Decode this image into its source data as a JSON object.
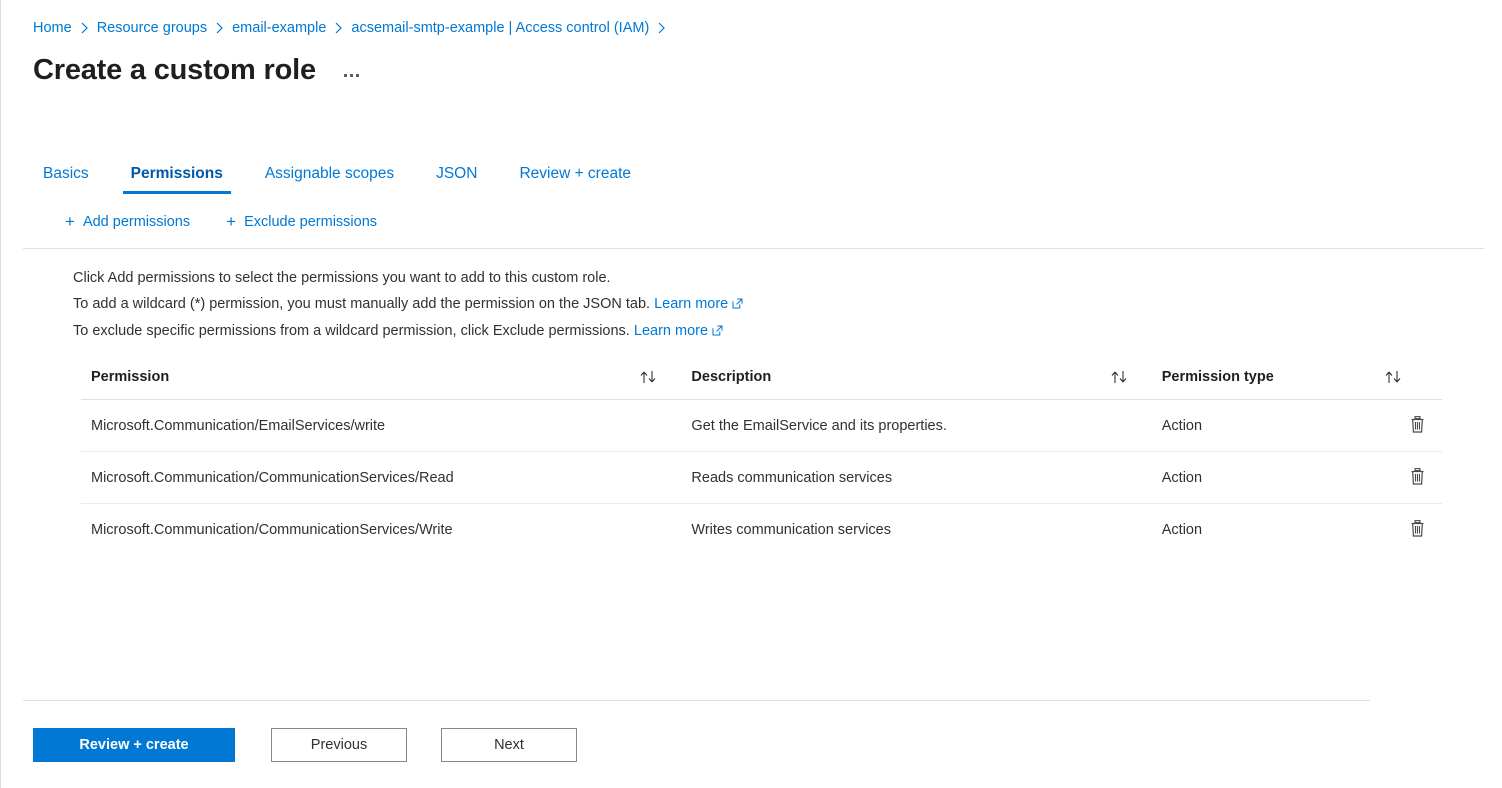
{
  "breadcrumb": {
    "separator_icon": "chevron-right-icon",
    "items": [
      {
        "label": "Home"
      },
      {
        "label": "Resource groups"
      },
      {
        "label": "email-example"
      },
      {
        "label": "acsemail-smtp-example | Access control (IAM)"
      }
    ]
  },
  "header": {
    "title": "Create a custom role",
    "more_menu_icon": "ellipsis-icon"
  },
  "tabs": [
    {
      "label": "Basics",
      "active": false
    },
    {
      "label": "Permissions",
      "active": true
    },
    {
      "label": "Assignable scopes",
      "active": false
    },
    {
      "label": "JSON",
      "active": false
    },
    {
      "label": "Review + create",
      "active": false
    }
  ],
  "command_bar": {
    "add_permissions_label": "Add permissions",
    "exclude_permissions_label": "Exclude permissions",
    "add_icon": "plus-icon",
    "exclude_icon": "plus-icon"
  },
  "instructions": {
    "line1": "Click Add permissions to select the permissions you want to add to this custom role.",
    "line2_text": "To add a wildcard (*) permission, you must manually add the permission on the JSON tab.",
    "line2_link": "Learn more",
    "line3_text": "To exclude specific permissions from a wildcard permission, click Exclude permissions.",
    "line3_link": "Learn more",
    "external_link_icon": "external-link-icon"
  },
  "table": {
    "columns": [
      {
        "label": "Permission",
        "sortable": true,
        "sort_icon": "sort-updown-icon"
      },
      {
        "label": "Description",
        "sortable": true,
        "sort_icon": "sort-updown-icon"
      },
      {
        "label": "Permission type",
        "sortable": true,
        "sort_icon": "sort-updown-icon"
      },
      {
        "label": "",
        "sortable": false
      }
    ],
    "rows": [
      {
        "permission": "Microsoft.Communication/EmailServices/write",
        "description": "Get the EmailService and its properties.",
        "type": "Action",
        "delete_icon": "trash-icon"
      },
      {
        "permission": "Microsoft.Communication/CommunicationServices/Read",
        "description": "Reads communication services",
        "type": "Action",
        "delete_icon": "trash-icon"
      },
      {
        "permission": "Microsoft.Communication/CommunicationServices/Write",
        "description": "Writes communication services",
        "type": "Action",
        "delete_icon": "trash-icon"
      }
    ]
  },
  "footer": {
    "review_create_label": "Review + create",
    "previous_label": "Previous",
    "next_label": "Next"
  },
  "colors": {
    "accent": "#0078d4",
    "active_tab": "#0058a6",
    "text": "#323130",
    "border": "#e1dfdd",
    "row_border": "#edebe9"
  }
}
